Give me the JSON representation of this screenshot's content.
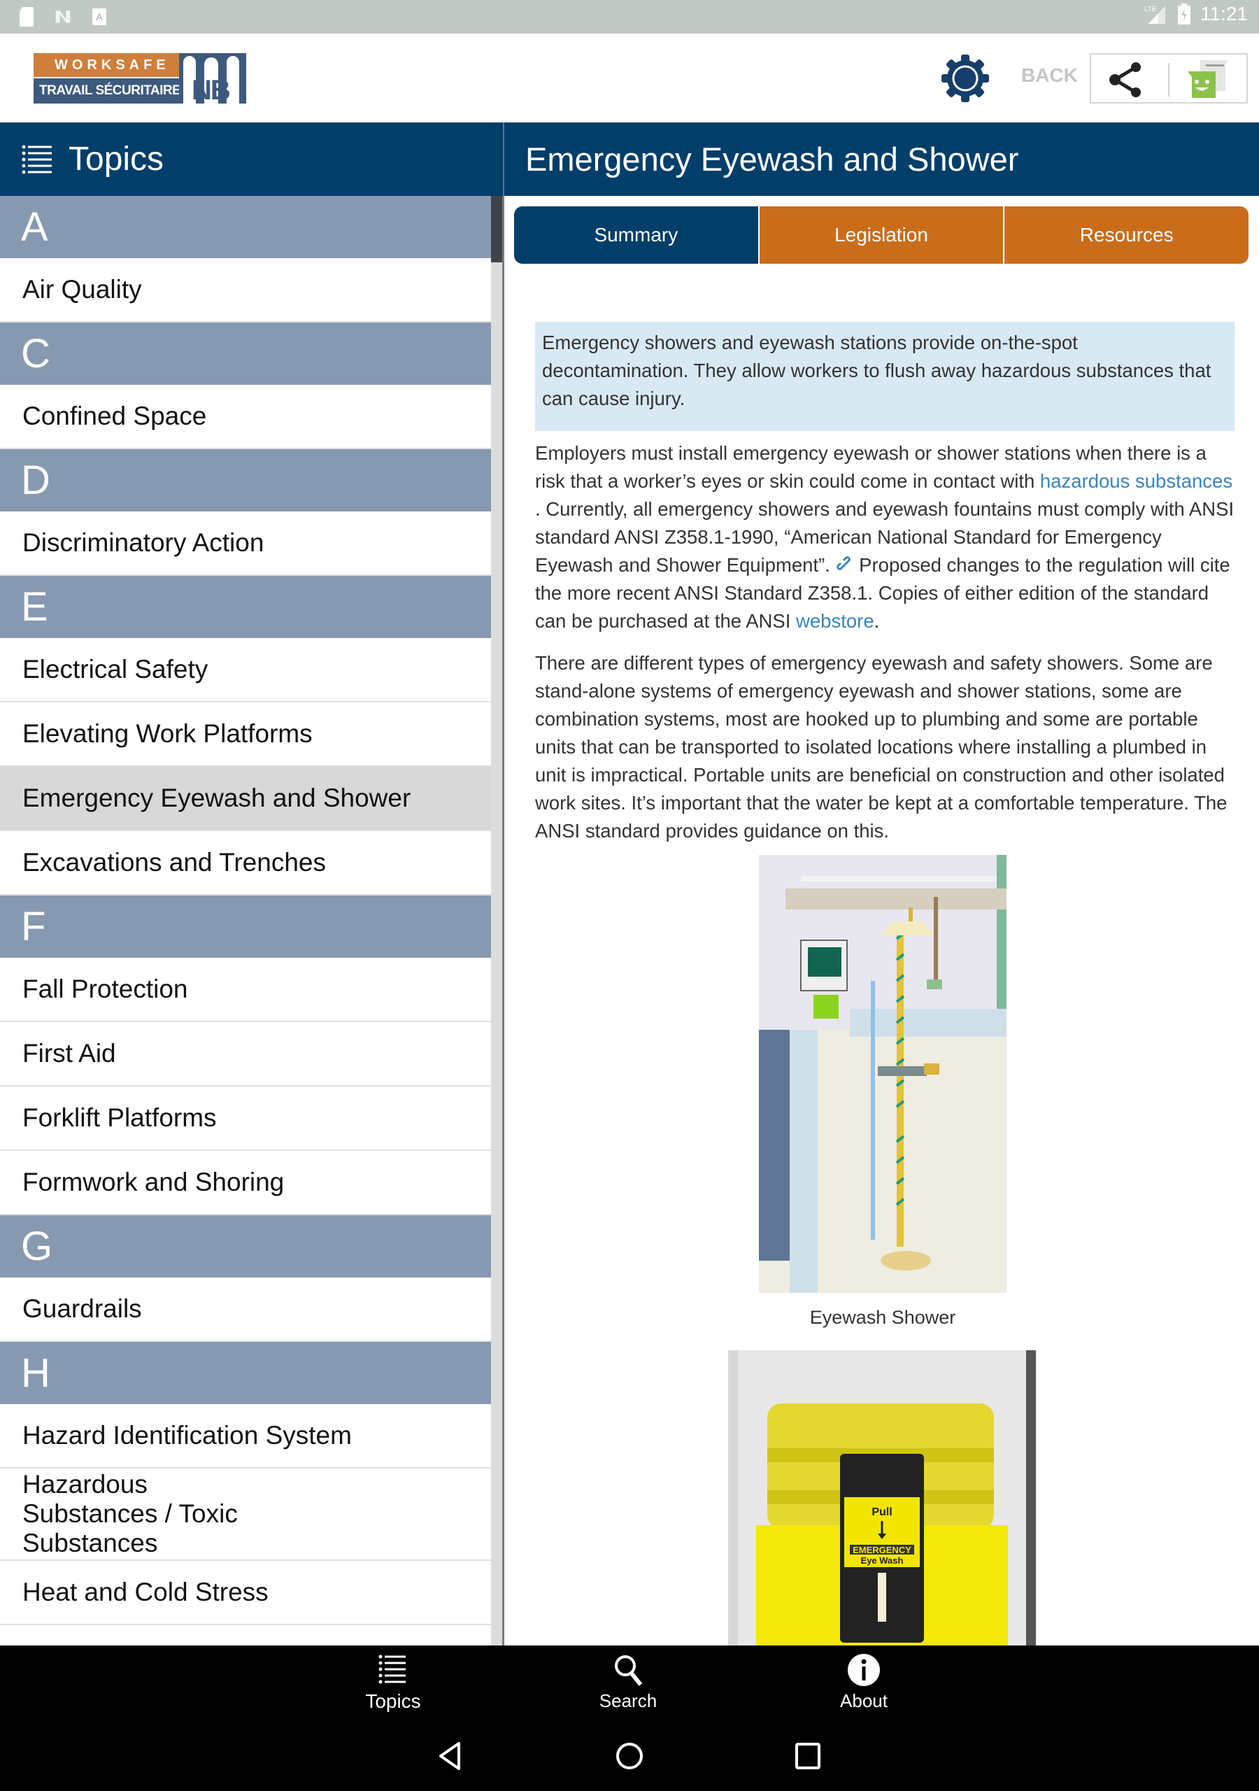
{
  "status_bar": {
    "left_icons": [
      "sd-card-icon",
      "n-icon",
      "a-icon"
    ],
    "network": "LTE",
    "time": "11:21"
  },
  "header": {
    "logo": {
      "line1": "WORKSAFE",
      "line2": "TRAVAIL SÉCURITAIRE",
      "badge": "NB"
    },
    "back_label": "BACK",
    "settings_icon": "gear-icon",
    "share_icon": "share-icon",
    "message_icon": "message-icon"
  },
  "sidebar": {
    "title": "Topics",
    "rows": [
      {
        "type": "section",
        "label": "A"
      },
      {
        "type": "item",
        "label": "Air Quality"
      },
      {
        "type": "section",
        "label": "C"
      },
      {
        "type": "item",
        "label": "Confined Space"
      },
      {
        "type": "section",
        "label": "D"
      },
      {
        "type": "item",
        "label": "Discriminatory Action"
      },
      {
        "type": "section",
        "label": "E"
      },
      {
        "type": "item",
        "label": "Electrical Safety"
      },
      {
        "type": "item",
        "label": "Elevating Work Platforms"
      },
      {
        "type": "item",
        "label": "Emergency Eyewash and Shower",
        "selected": true
      },
      {
        "type": "item",
        "label": "Excavations and Trenches"
      },
      {
        "type": "section",
        "label": "F"
      },
      {
        "type": "item",
        "label": "Fall Protection"
      },
      {
        "type": "item",
        "label": "First Aid"
      },
      {
        "type": "item",
        "label": "Forklift Platforms"
      },
      {
        "type": "item",
        "label": "Formwork and Shoring"
      },
      {
        "type": "section",
        "label": "G"
      },
      {
        "type": "item",
        "label": "Guardrails"
      },
      {
        "type": "section",
        "label": "H"
      },
      {
        "type": "item",
        "label": "Hazard Identification System"
      },
      {
        "type": "item",
        "label": "Hazardous Substances / Toxic Substances",
        "tall": true
      },
      {
        "type": "item",
        "label": "Heat and Cold Stress"
      },
      {
        "type": "item",
        "label": ""
      }
    ]
  },
  "content": {
    "title": "Emergency Eyewash and Shower",
    "tabs": [
      {
        "label": "Summary",
        "active": true
      },
      {
        "label": "Legislation",
        "active": false
      },
      {
        "label": "Resources",
        "active": false
      }
    ],
    "callout": "Emergency showers and eyewash stations provide on-the-spot decontamination. They allow workers to flush away hazardous substances that can cause injury.",
    "para1": {
      "text_a": "Employers must install emergency eyewash or shower stations when there is a risk that a worker’s eyes or skin could come in contact with ",
      "link_a": "hazardous substances",
      "text_b": " . Currently, all emergency showers and eyewash fountains must comply with ANSI standard ANSI Z358.1-1990, “American National Standard for Emergency Eyewash and Shower Equipment”. ",
      "text_c": " Proposed changes to the regulation will cite the more recent ANSI Standard Z358.1. Copies of either edition of the standard can be purchased at the ANSI ",
      "link_b": "webstore",
      "text_d": "."
    },
    "para2": "There are different types of emergency eyewash and safety showers. Some are stand-alone systems of emergency eyewash and shower stations, some are combination systems, most are hooked up to plumbing and some are portable units that can be transported to isolated locations where installing a plumbed in unit is impractical. Portable units are beneficial on construction and other isolated work sites. It’s important that the water be kept at a comfortable temperature. The ANSI standard provides guidance on this.",
    "figure1_caption": "Eyewash Shower",
    "figure2_text": {
      "pull": "Pull",
      "emergency": "EMERGENCY",
      "eye_wash": "Eye Wash"
    }
  },
  "bottom_nav": [
    {
      "label": "Topics",
      "icon": "list-icon"
    },
    {
      "label": "Search",
      "icon": "search-icon"
    },
    {
      "label": "About",
      "icon": "info-icon"
    }
  ],
  "colors": {
    "navy": "#023e6a",
    "orange": "#ca6d1b",
    "section_header": "#8799b0",
    "selected_row": "#d8d8d8",
    "callout_bg": "#d8e9f4",
    "link": "#3a84bd"
  }
}
